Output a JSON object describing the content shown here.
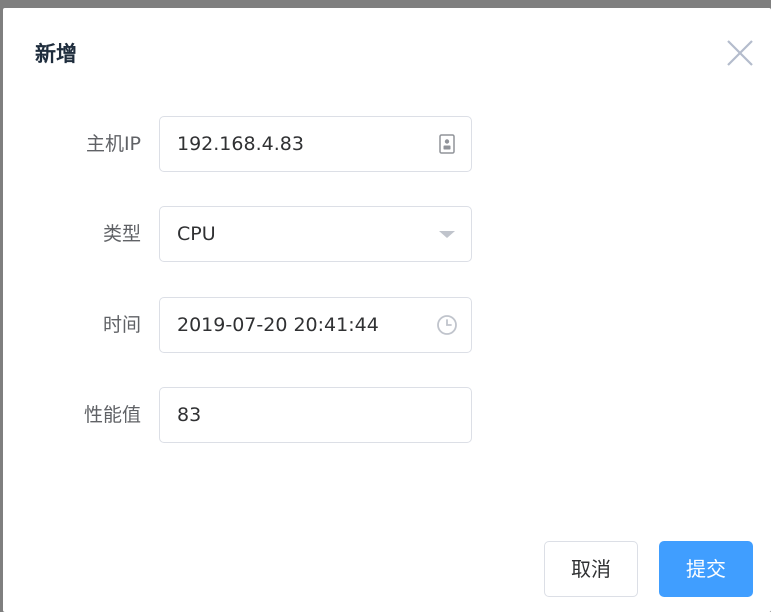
{
  "dialog": {
    "title": "新增",
    "close_icon": "close-icon"
  },
  "form": {
    "host_ip": {
      "label": "主机IP",
      "value": "192.168.4.83",
      "icon": "id-card-icon"
    },
    "type": {
      "label": "类型",
      "value": "CPU",
      "icon": "chevron-down-icon"
    },
    "time": {
      "label": "时间",
      "value": "2019-07-20 20:41:44",
      "icon": "clock-icon"
    },
    "performance": {
      "label": "性能值",
      "value": "83"
    }
  },
  "buttons": {
    "cancel_label": "取消",
    "submit_label": "提交"
  },
  "colors": {
    "primary": "#409eff",
    "border": "#dcdfe6",
    "label": "#606266",
    "icon": "#c0c4cc"
  }
}
